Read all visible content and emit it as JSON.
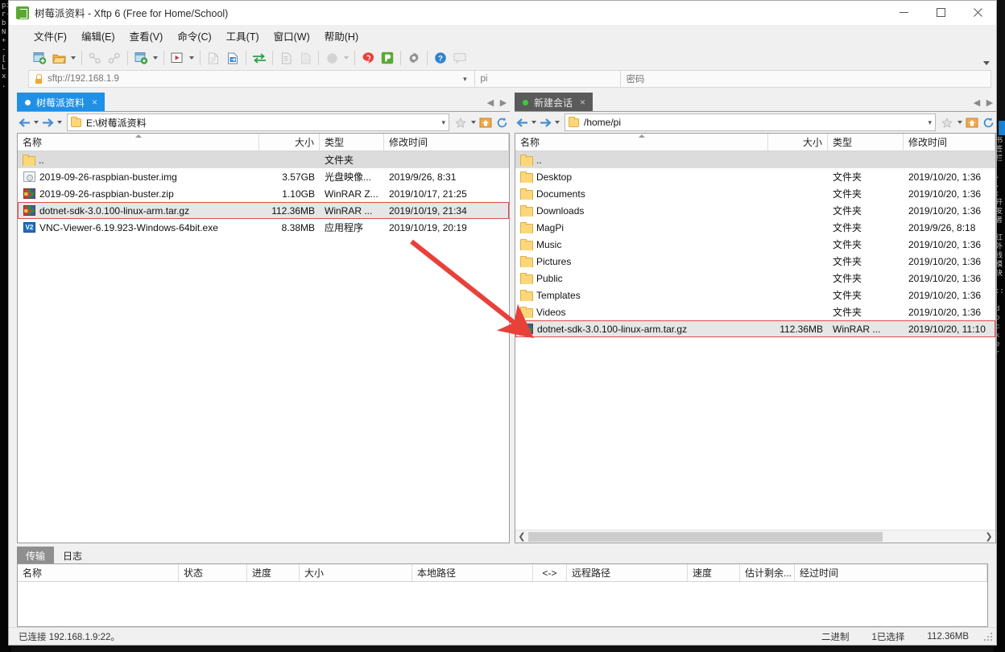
{
  "window": {
    "title": "树莓派资料 - Xftp 6 (Free for Home/School)",
    "app_icon": "xftp-icon",
    "controls": {
      "minimize": "−",
      "maximize": "□",
      "close": "✕"
    }
  },
  "menubar": {
    "items": [
      {
        "label": "文件(F)",
        "name": "menu-file"
      },
      {
        "label": "编辑(E)",
        "name": "menu-edit"
      },
      {
        "label": "查看(V)",
        "name": "menu-view"
      },
      {
        "label": "命令(C)",
        "name": "menu-command"
      },
      {
        "label": "工具(T)",
        "name": "menu-tools"
      },
      {
        "label": "窗口(W)",
        "name": "menu-window"
      },
      {
        "label": "帮助(H)",
        "name": "menu-help"
      }
    ]
  },
  "toolbar": {
    "overflow_label": "",
    "buttons": [
      "new-session-icon",
      "open-folder-icon",
      "copy-icon",
      "paste-icon",
      "new-file-transfer-icon",
      "run-icon",
      "edit-file-icon",
      "transfer-file-icon",
      "sync-icon",
      "properties-icon",
      "duplicate-icon",
      "color-icon",
      "xshell-icon",
      "xftp-icon",
      "settings-gear-icon",
      "help-icon",
      "feedback-icon"
    ]
  },
  "connectbar": {
    "url": "sftp://192.168.1.9",
    "url_placeholder": "",
    "user": "pi",
    "password_placeholder": "密码",
    "password": ""
  },
  "left_pane": {
    "tab": {
      "label": "树莓派资料",
      "close": "×",
      "dot": "blue"
    },
    "path": "E:\\树莓派资料",
    "columns": [
      "名称",
      "大小",
      "类型",
      "修改时间"
    ],
    "sort_column": "名称",
    "sort_direction": "asc",
    "rows": [
      {
        "icon": "folder",
        "name": "..",
        "size": "",
        "type": "文件夹",
        "modified": ""
      },
      {
        "icon": "iso",
        "name": "2019-09-26-raspbian-buster.img",
        "size": "3.57GB",
        "type": "光盘映像...",
        "modified": "2019/9/26, 8:31"
      },
      {
        "icon": "rar",
        "name": "2019-09-26-raspbian-buster.zip",
        "size": "1.10GB",
        "type": "WinRAR Z...",
        "modified": "2019/10/17, 21:25"
      },
      {
        "icon": "rar",
        "name": "dotnet-sdk-3.0.100-linux-arm.tar.gz",
        "size": "112.36MB",
        "type": "WinRAR ...",
        "modified": "2019/10/19, 21:34",
        "selected": true,
        "highlighted": true
      },
      {
        "icon": "exe",
        "name": "VNC-Viewer-6.19.923-Windows-64bit.exe",
        "size": "8.38MB",
        "type": "应用程序",
        "modified": "2019/10/19, 20:19"
      }
    ]
  },
  "right_pane": {
    "tab": {
      "label": "新建会话",
      "close": "×",
      "dot": "green"
    },
    "path": "/home/pi",
    "columns": [
      "名称",
      "大小",
      "类型",
      "修改时间"
    ],
    "sort_column": "名称",
    "sort_direction": "asc",
    "rows": [
      {
        "icon": "folder",
        "name": "..",
        "size": "",
        "type": "",
        "modified": ""
      },
      {
        "icon": "folder",
        "name": "Desktop",
        "size": "",
        "type": "文件夹",
        "modified": "2019/10/20, 1:36"
      },
      {
        "icon": "folder",
        "name": "Documents",
        "size": "",
        "type": "文件夹",
        "modified": "2019/10/20, 1:36"
      },
      {
        "icon": "folder",
        "name": "Downloads",
        "size": "",
        "type": "文件夹",
        "modified": "2019/10/20, 1:36"
      },
      {
        "icon": "folder",
        "name": "MagPi",
        "size": "",
        "type": "文件夹",
        "modified": "2019/9/26, 8:18"
      },
      {
        "icon": "folder",
        "name": "Music",
        "size": "",
        "type": "文件夹",
        "modified": "2019/10/20, 1:36"
      },
      {
        "icon": "folder",
        "name": "Pictures",
        "size": "",
        "type": "文件夹",
        "modified": "2019/10/20, 1:36"
      },
      {
        "icon": "folder",
        "name": "Public",
        "size": "",
        "type": "文件夹",
        "modified": "2019/10/20, 1:36"
      },
      {
        "icon": "folder",
        "name": "Templates",
        "size": "",
        "type": "文件夹",
        "modified": "2019/10/20, 1:36"
      },
      {
        "icon": "folder",
        "name": "Videos",
        "size": "",
        "type": "文件夹",
        "modified": "2019/10/20, 1:36"
      },
      {
        "icon": "rar",
        "name": "dotnet-sdk-3.0.100-linux-arm.tar.gz",
        "size": "112.36MB",
        "type": "WinRAR ...",
        "modified": "2019/10/20, 11:10",
        "selected": true,
        "highlighted": true
      }
    ]
  },
  "bottom": {
    "tabs": [
      {
        "label": "传输",
        "active": true
      },
      {
        "label": "日志",
        "active": false
      }
    ],
    "columns": [
      "名称",
      "状态",
      "进度",
      "大小",
      "本地路径",
      "<->",
      "远程路径",
      "速度",
      "估计剩余...",
      "经过时间"
    ],
    "rows": []
  },
  "statusbar": {
    "connection": "已连接 192.168.1.9:22。",
    "mode": "二进制",
    "selection": "1已选择",
    "total_size": "112.36MB"
  },
  "annotation": {
    "arrow_color": "#e8413a",
    "from": "左侧 dotnet-sdk 文件",
    "to": "右侧 dotnet-sdk 文件"
  },
  "colors": {
    "tab_active_blue": "#1e90e8",
    "tab_active_grey": "#5a5a5a",
    "highlight_red": "#e04a4a",
    "selection_grey": "#e6e6e6"
  }
}
